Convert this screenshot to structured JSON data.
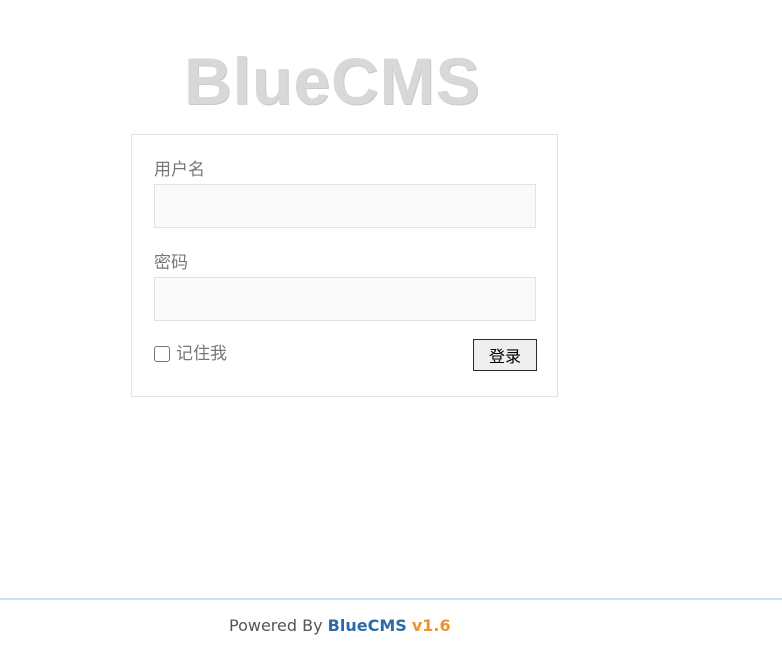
{
  "logo": {
    "text": "BlueCMS"
  },
  "form": {
    "username_label": "用户名",
    "username_value": "",
    "password_label": "密码",
    "password_value": "",
    "remember_label": "记住我",
    "remember_checked": false,
    "login_label": "登录"
  },
  "footer": {
    "powered_by": "Powered By",
    "brand": "BlueCMS",
    "version": "v1.6"
  },
  "colors": {
    "brand": "#2c6aa8",
    "version": "#f0922d",
    "logo": "#d8d8db",
    "footer_line": "#cfe3ef"
  }
}
